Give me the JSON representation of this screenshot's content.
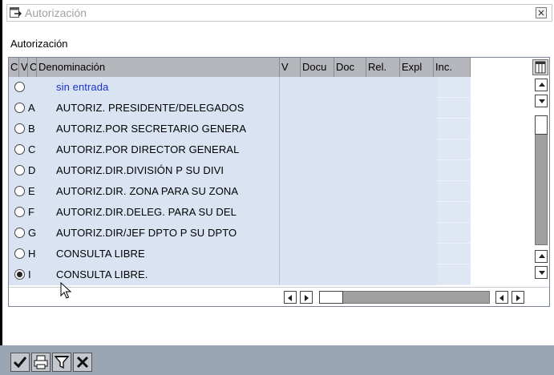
{
  "window": {
    "title": "Autorización"
  },
  "section_label": "Autorización",
  "grid": {
    "columns": [
      "C",
      "V",
      "C",
      "Denominación",
      "V",
      "Docu",
      "Doc",
      "Rel.",
      "Expl",
      "Inc."
    ],
    "rows": [
      {
        "code": "",
        "label": "sin entrada",
        "selected": false
      },
      {
        "code": "A",
        "label": "AUTORIZ.  PRESIDENTE/DELEGADOS",
        "selected": false
      },
      {
        "code": "B",
        "label": "AUTORIZ.POR SECRETARIO GENERA",
        "selected": false
      },
      {
        "code": "C",
        "label": "AUTORIZ.POR DIRECTOR GENERAL",
        "selected": false
      },
      {
        "code": "D",
        "label": "AUTORIZ.DIR.DIVISIÓN P SU DIVI",
        "selected": false
      },
      {
        "code": "E",
        "label": "AUTORIZ.DIR. ZONA PARA SU ZONA",
        "selected": false
      },
      {
        "code": "F",
        "label": "AUTORIZ.DIR.DELEG. PARA SU DEL",
        "selected": false
      },
      {
        "code": "G",
        "label": "AUTORIZ.DIR/JEF DPTO P SU DPTO",
        "selected": false
      },
      {
        "code": "H",
        "label": "CONSULTA LIBRE",
        "selected": false
      },
      {
        "code": "I",
        "label": "CONSULTA LIBRE.",
        "selected": true
      }
    ]
  },
  "toolbar": {
    "buttons": [
      "checkmark-icon",
      "printer-icon",
      "filter-icon",
      "close-icon"
    ]
  },
  "colors": {
    "row_bg": "#d9e3f2",
    "header_bg": "#b5b7bc",
    "link_text": "#1a33cc",
    "toolbar_bg": "#9aa5b3"
  }
}
